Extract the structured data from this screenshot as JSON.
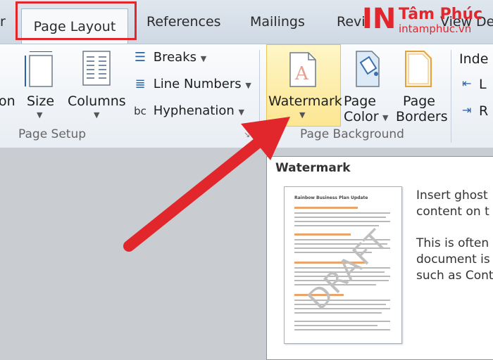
{
  "tabs": {
    "left_partial": "r",
    "active": "Page Layout",
    "references": "References",
    "mailings": "Mailings",
    "review_partial": "Revi",
    "view_partial": "View",
    "developer_partial": "De"
  },
  "page_setup": {
    "orientation_partial": "on",
    "size": "Size",
    "columns": "Columns",
    "breaks": "Breaks",
    "line_numbers": "Line Numbers",
    "hyphenation": "Hyphenation",
    "group_label": "Page Setup"
  },
  "page_background": {
    "watermark": "Watermark",
    "page_color_1": "Page",
    "page_color_2": "Color",
    "page_borders_1": "Page",
    "page_borders_2": "Borders",
    "group_label": "Page Background"
  },
  "paragraph": {
    "indent_partial": "Inde",
    "left_partial": "L",
    "right_partial": "R"
  },
  "tooltip": {
    "title": "Watermark",
    "line1": "Insert ghost",
    "line2": "content on t",
    "line3": "This is often",
    "line4": "document is",
    "line5": "such as Cont",
    "thumb_title": "Rainbow Business Plan Update",
    "thumb_watermark": "DRAFT"
  },
  "logo": {
    "mark": "IN",
    "name": "Tâm Phúc",
    "url": "intamphuc.vn"
  },
  "colors": {
    "highlight_red": "#e1262c",
    "watermark_hover": "#fbe691"
  }
}
